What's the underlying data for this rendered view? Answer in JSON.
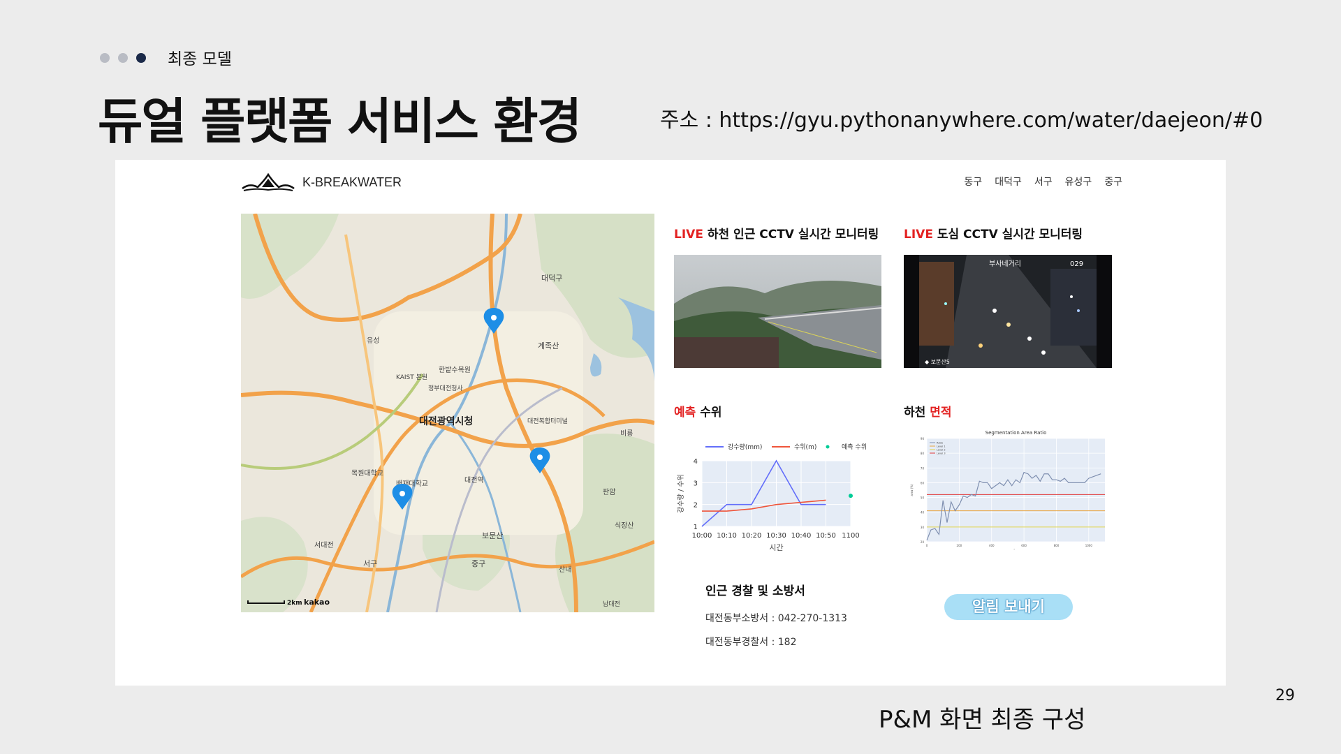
{
  "slide": {
    "breadcrumb": "최종 모델",
    "title": "듀얼 플랫폼 서비스 환경",
    "address": "주소 : https://gyu.pythonanywhere.com/water/daejeon/#0",
    "page_number": "29",
    "caption": "P&M 화면 최종 구성"
  },
  "app": {
    "brand": "K-BREAKWATER",
    "nav": [
      "동구",
      "대덕구",
      "서구",
      "유성구",
      "중구"
    ],
    "map": {
      "labels": [
        "대전광역시청",
        "대덕구",
        "계족산",
        "보문산",
        "식장산",
        "서대전",
        "유성",
        "대전역",
        "한밭수목원",
        "KAIST 본원",
        "대전복합터미널",
        "정부대전청사",
        "목원대학교",
        "배재대학교",
        "산내",
        "판암",
        "비룡",
        "남대전",
        "중구",
        "서구"
      ],
      "scale_text": "2km",
      "brand": "kakao",
      "markers": 3
    },
    "cctv": {
      "river": {
        "live": "LIVE",
        "title": " 하천 인근 CCTV 실시간 모니터링"
      },
      "city": {
        "live": "LIVE",
        "title": " 도심 CCTV 실시간 모니터링",
        "overlay_left": "부사네거리",
        "overlay_right": "029",
        "overlay_bottom": "◆ 보문산5"
      }
    },
    "forecast": {
      "title_red": "예측",
      "title_rest": " 수위"
    },
    "river_area": {
      "title_plain": "하천 ",
      "title_red": "면적"
    },
    "contacts": {
      "heading": "인근 경찰 및 소방서",
      "rows": [
        "대전동부소방서 : 042-270-1313",
        "대전동부경찰서 : 182"
      ]
    },
    "alert_button": "알림 보내기"
  },
  "colors": {
    "accent_red": "#e32222",
    "button_bg": "#a9dff6",
    "dot_active": "#1b2a49",
    "dot_inactive": "#b9bcc4"
  },
  "chart_data": [
    {
      "type": "line",
      "title": "",
      "xlabel": "시간",
      "ylabel": "강수량 / 수위",
      "categories": [
        "10:00",
        "10:10",
        "10:20",
        "10:30",
        "10:40",
        "10:50",
        "1100"
      ],
      "ylim": [
        1,
        4
      ],
      "series": [
        {
          "name": "강수량(mm)",
          "color": "#636efa",
          "values": [
            1,
            2,
            2,
            4,
            2,
            2,
            null
          ]
        },
        {
          "name": "수위(m)",
          "color": "#ef553b",
          "values": [
            1.7,
            1.7,
            1.8,
            2.0,
            2.1,
            2.2,
            null
          ]
        },
        {
          "name": "예측 수위",
          "color": "#00cc96",
          "values": [
            null,
            null,
            null,
            null,
            null,
            null,
            2.4
          ]
        }
      ],
      "legend": "top",
      "grid": true
    },
    {
      "type": "line",
      "title": "Segmentation Area Ratio",
      "xlabel": "Sec",
      "ylabel": "area (%)",
      "ylim": [
        20,
        90
      ],
      "xlim": [
        0,
        1100
      ],
      "xticks": [
        "0",
        "200",
        "400",
        "600",
        "800",
        "1000"
      ],
      "yticks": [
        "20",
        "30",
        "40",
        "50",
        "60",
        "70",
        "80",
        "90"
      ],
      "series": [
        {
          "name": "Ratio",
          "color": "#7f8fb0",
          "x": [
            0,
            25,
            50,
            75,
            100,
            125,
            150,
            175,
            200,
            225,
            250,
            275,
            300,
            325,
            350,
            375,
            400,
            425,
            450,
            475,
            500,
            525,
            550,
            575,
            600,
            625,
            650,
            675,
            700,
            725,
            750,
            775,
            800,
            825,
            850,
            875,
            900,
            925,
            950,
            975,
            1000,
            1025,
            1050,
            1075
          ],
          "values": [
            21,
            28,
            29,
            25,
            48,
            33,
            47,
            41,
            45,
            51,
            50,
            52,
            51,
            61,
            60,
            60,
            56,
            58,
            60,
            58,
            62,
            58,
            62,
            60,
            67,
            66,
            63,
            65,
            61,
            66,
            66,
            62,
            62,
            61,
            63,
            60,
            60,
            60,
            60,
            60,
            63,
            64,
            65,
            66
          ]
        },
        {
          "name": "Level 1",
          "color": "#e8a33d",
          "values": [
            41
          ]
        },
        {
          "name": "Level 2",
          "color": "#e0d24a",
          "values": [
            30
          ]
        },
        {
          "name": "Level 3",
          "color": "#e23a3a",
          "values": [
            52
          ]
        }
      ],
      "legend": "top-left",
      "grid": true
    }
  ]
}
